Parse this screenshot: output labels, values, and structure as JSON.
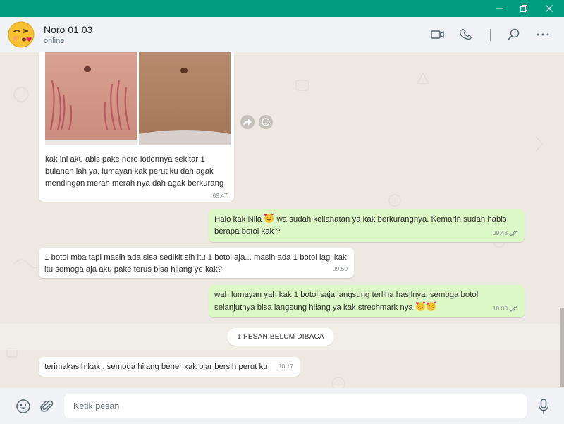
{
  "window": {
    "controls": [
      "minimize-icon",
      "restore-icon",
      "close-icon"
    ],
    "titlebar_color": "#009e80"
  },
  "header": {
    "contact_name": "Noro 01 03",
    "status": "online",
    "avatar": "kissing-face-emoji",
    "actions": [
      "video-call-icon",
      "voice-call-icon",
      "search-icon",
      "more-options-icon"
    ]
  },
  "messages": [
    {
      "direction": "in",
      "type": "image",
      "images": [
        "before-stretch-marks-photo",
        "after-stretch-marks-photo"
      ],
      "text": "kak ini aku abis pake noro lotionnya sekitar 1 bulanan lah ya,  lumayan kak perut ku dah agak mendingan merah merah nya dah agak berkurang",
      "time": "09.47"
    },
    {
      "direction": "out",
      "text_before_emoji": "Halo kak Nila",
      "text_after_emoji": " wa sudah keliahatan ya kak berkurangnya. Kemarin sudah habis berapa botol kak ?",
      "time": "09.48",
      "status": "read"
    },
    {
      "direction": "in",
      "text": "1 botol mba tapi masih ada sisa sedikit sih itu 1 botol aja...  masih ada 1 botol lagi kak itu semoga aja aku pake terus bisa hilang ye kak?",
      "time": "09.50"
    },
    {
      "direction": "out",
      "text": "wah lumayan yah kak 1 botol saja langsung terliha hasilnya. semoga botol selanjutnya bisa langsung hilang ya kak strechmark nya ",
      "time": "10.00",
      "status": "read"
    },
    {
      "direction": "in",
      "text": "terimakasih kak . semoga hilang bener kak biar bersih perut ku",
      "time": "10.17"
    }
  ],
  "unread_divider": "1 PESAN BELUM DIBACA",
  "composer": {
    "placeholder": "Ketik pesan",
    "left_icons": [
      "emoji-icon",
      "attach-icon"
    ],
    "right_icon": "microphone-icon"
  },
  "colors": {
    "outgoing_bubble": "#dcf8c6",
    "incoming_bubble": "#ffffff",
    "chat_background": "#ede8e1",
    "read_ticks": "#8a8f93"
  }
}
